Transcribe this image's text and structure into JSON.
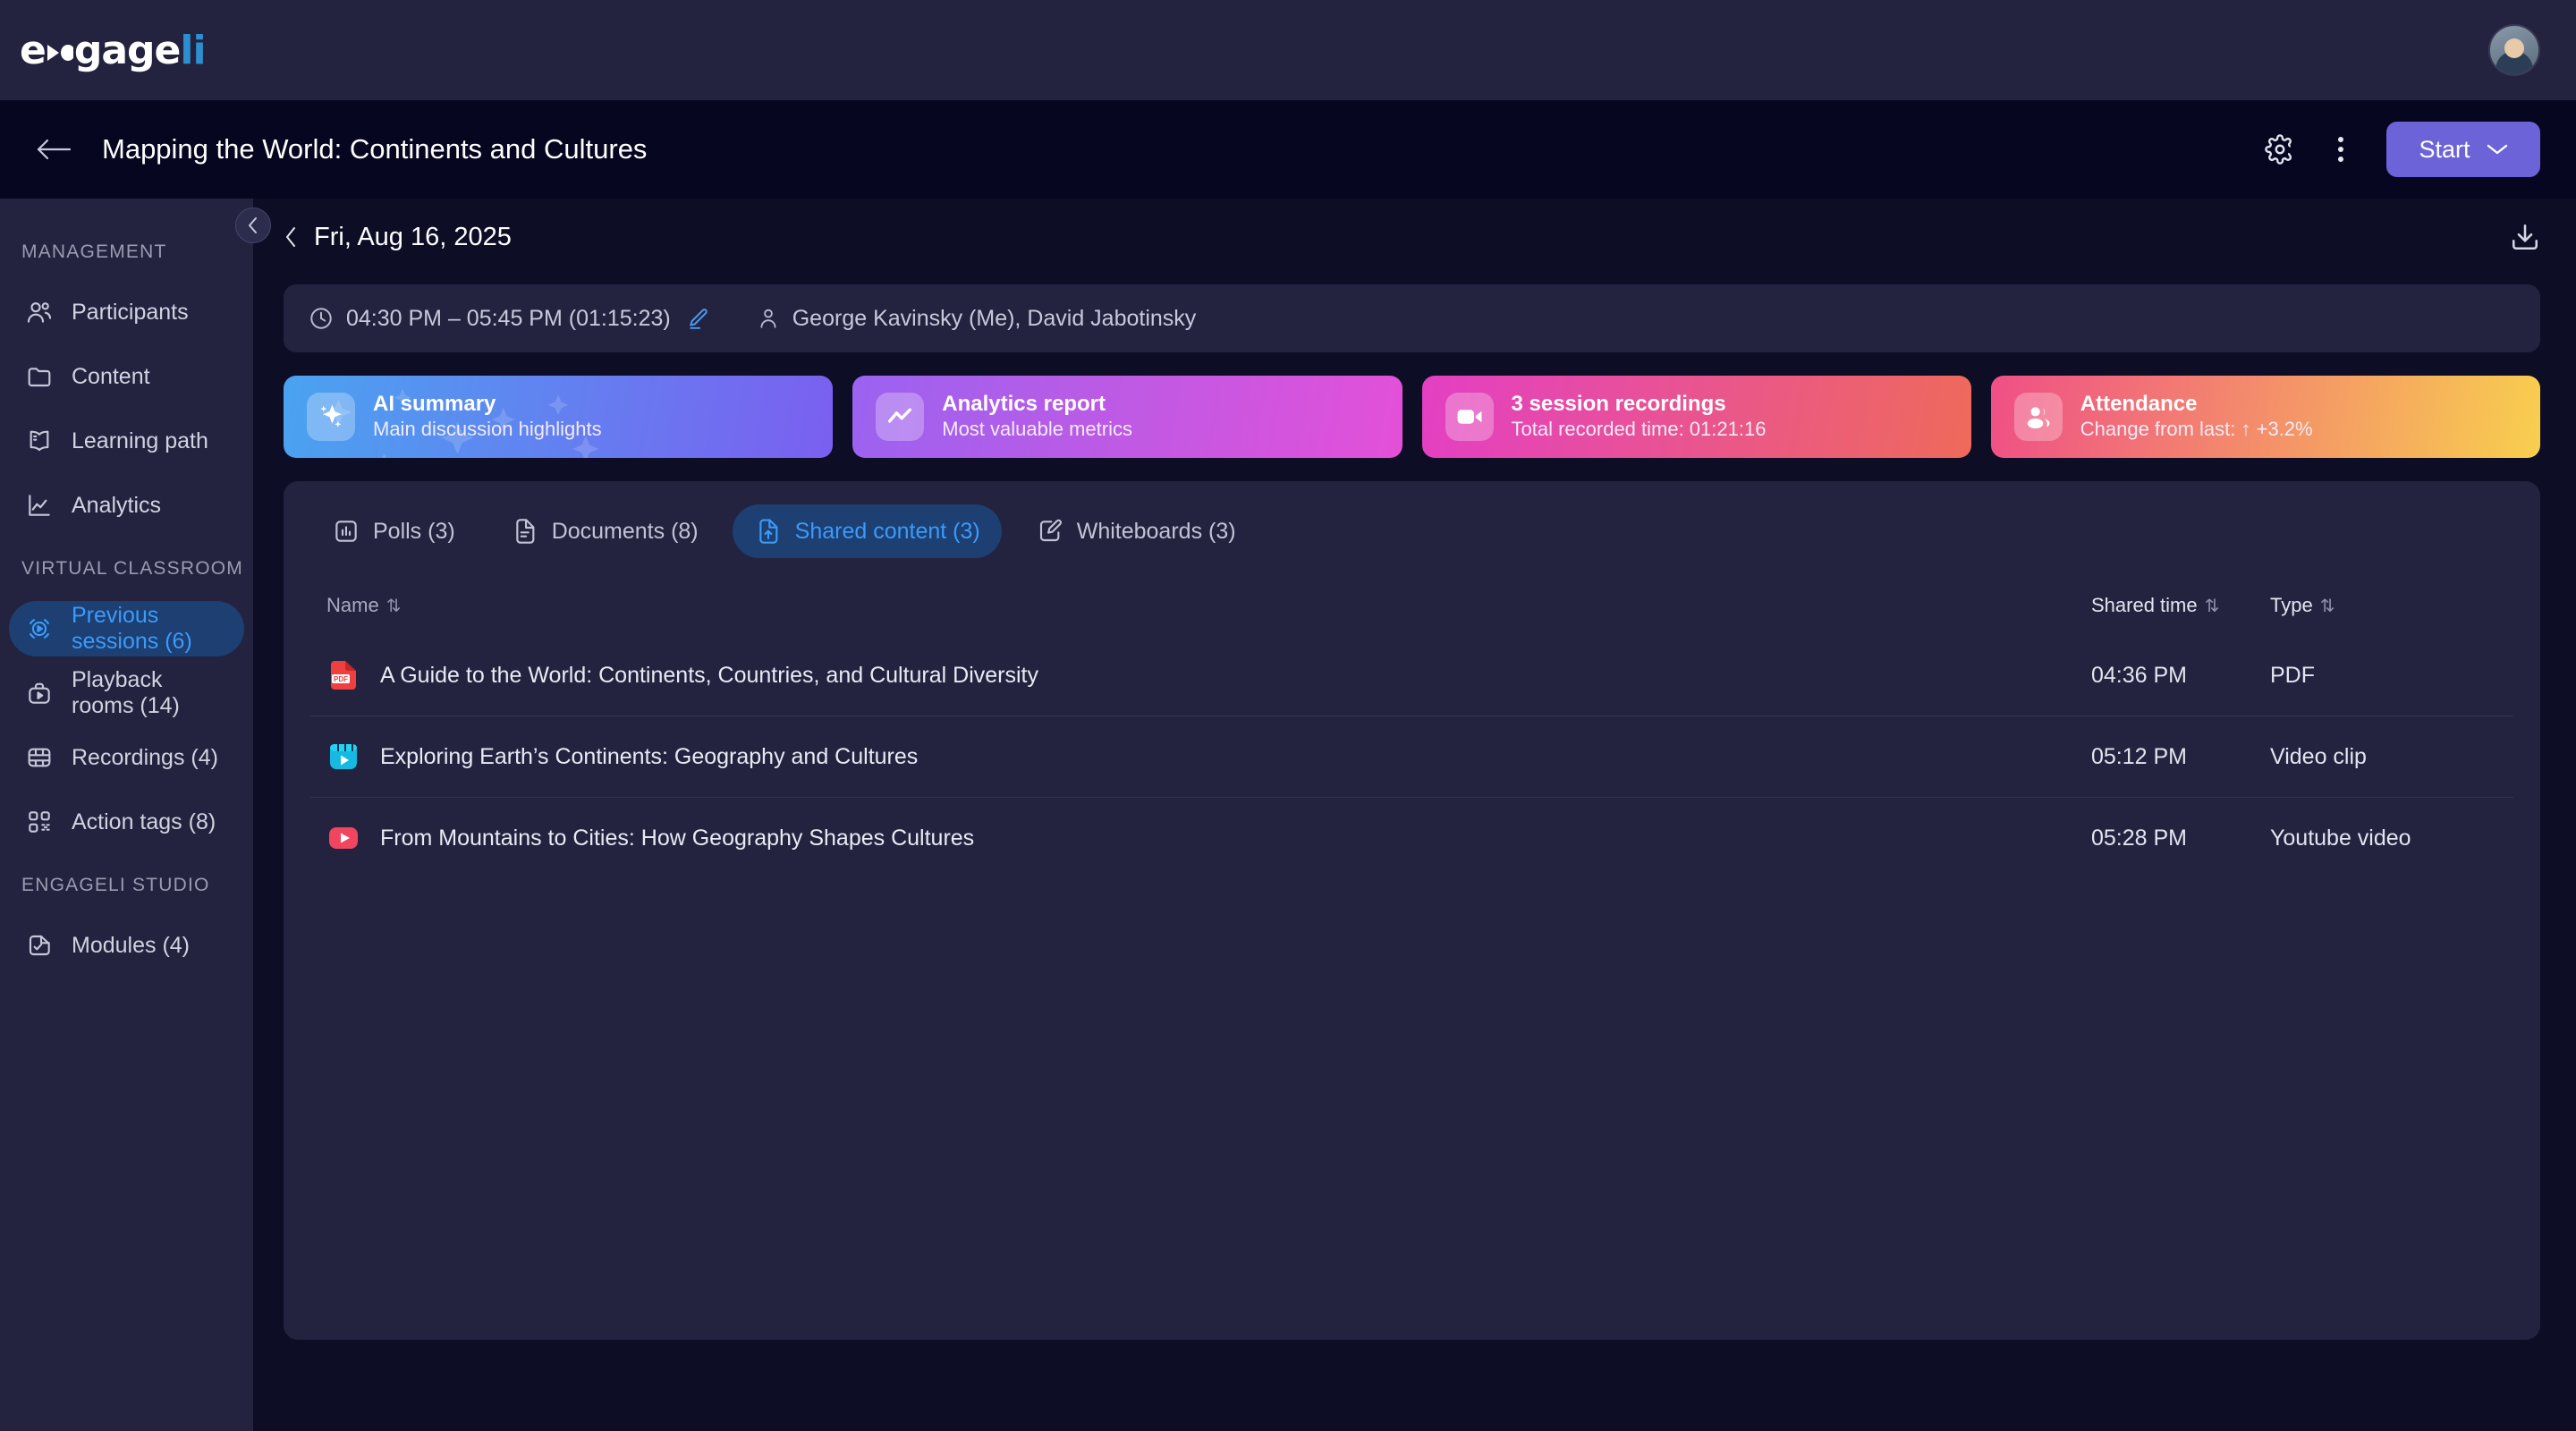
{
  "brand": {
    "name_part1": "e",
    "name_part2": "gage",
    "name_part3": "li",
    "avatar_name": "user-avatar"
  },
  "header": {
    "back_icon": "arrow-left-icon",
    "title": "Mapping the World: Continents and Cultures",
    "settings_icon": "gear-icon",
    "more_icon": "kebab-menu-icon",
    "start_label": "Start",
    "start_chevron": "chevron-down-icon"
  },
  "sidebar": {
    "collapse_icon": "chevron-left-icon",
    "groups": [
      {
        "label": "MANAGEMENT",
        "items": [
          {
            "label": "Participants",
            "icon": "users-icon",
            "active": false
          },
          {
            "label": "Content",
            "icon": "folder-icon",
            "active": false
          },
          {
            "label": "Learning path",
            "icon": "book-open-icon",
            "active": false
          },
          {
            "label": "Analytics",
            "icon": "line-chart-icon",
            "active": false
          }
        ]
      },
      {
        "label": "VIRTUAL CLASSROOM",
        "items": [
          {
            "label": "Previous sessions (6)",
            "icon": "play-circle-icon",
            "active": true
          },
          {
            "label": "Playback rooms (14)",
            "icon": "playback-room-icon",
            "active": false
          },
          {
            "label": "Recordings (4)",
            "icon": "film-icon",
            "active": false
          },
          {
            "label": "Action tags (8)",
            "icon": "qr-tag-icon",
            "active": false
          }
        ]
      },
      {
        "label": "ENGAGELI STUDIO",
        "items": [
          {
            "label": "Modules (4)",
            "icon": "module-check-icon",
            "active": false
          }
        ]
      }
    ]
  },
  "main": {
    "date_prev_icon": "chevron-left-icon",
    "date": "Fri, Aug 16, 2025",
    "download_icon": "download-icon",
    "meta": {
      "clock_icon": "clock-icon",
      "time_range": "04:30 PM – 05:45 PM (01:15:23)",
      "edit_icon": "pencil-edit-icon",
      "person_icon": "person-icon",
      "participants": "George Kavinsky (Me), David Jabotinsky"
    },
    "cards": [
      {
        "title": "AI summary",
        "subtitle": "Main discussion highlights",
        "icon": "sparkle-icon",
        "gradient_from": "#4aa3f0",
        "gradient_to": "#7b5ff0"
      },
      {
        "title": "Analytics report",
        "subtitle": "Most valuable metrics",
        "icon": "trend-line-icon",
        "gradient_from": "#9a63f0",
        "gradient_to": "#e450d8"
      },
      {
        "title": "3 session recordings",
        "subtitle": "Total recorded time: 01:21:16",
        "icon": "video-camera-icon",
        "gradient_from": "#e33fc4",
        "gradient_to": "#ef6a5a"
      },
      {
        "title": "Attendance",
        "subtitle": "Change from last: ↑ +3.2%",
        "icon": "attendance-people-icon",
        "gradient_from": "#ef4f86",
        "gradient_to": "#f8cf4e"
      }
    ],
    "tabs": [
      {
        "label": "Polls (3)",
        "icon": "poll-bars-icon",
        "active": false
      },
      {
        "label": "Documents (8)",
        "icon": "document-icon",
        "active": false
      },
      {
        "label": "Shared content (3)",
        "icon": "shared-content-icon",
        "active": true
      },
      {
        "label": "Whiteboards (3)",
        "icon": "whiteboard-pen-icon",
        "active": false
      }
    ],
    "table": {
      "columns": [
        {
          "label": "Name",
          "sort": "⇅"
        },
        {
          "label": "Shared time",
          "sort": "⇅"
        },
        {
          "label": "Type",
          "sort": "⇅"
        }
      ],
      "rows": [
        {
          "icon": "pdf-file-icon",
          "name": "A Guide to the World: Continents, Countries, and Cultural Diversity",
          "shared_time": "04:36 PM",
          "type": "PDF"
        },
        {
          "icon": "video-clip-icon",
          "name": "Exploring Earth’s Continents: Geography and Cultures",
          "shared_time": "05:12 PM",
          "type": "Video clip"
        },
        {
          "icon": "youtube-icon",
          "name": "From Mountains to Cities: How Geography Shapes Cultures",
          "shared_time": "05:28 PM",
          "type": "Youtube video"
        }
      ]
    }
  }
}
